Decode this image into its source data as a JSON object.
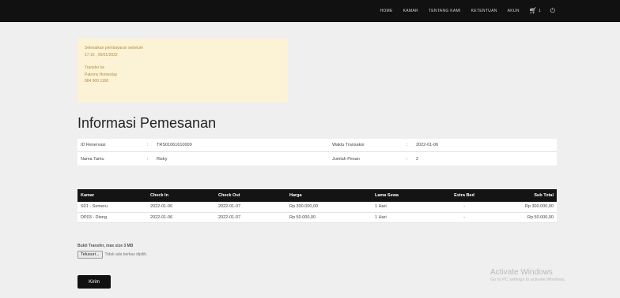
{
  "nav": {
    "links": [
      "HOME",
      "KAMAR",
      "TENTANG KAMI",
      "KETENTUAN",
      "AKUN"
    ],
    "cart_count": "1"
  },
  "notice": {
    "line1": "Selesaikan pembayaran sebelum",
    "line2": "17:16 , 06/01/2022",
    "line3": "Transfer ke",
    "line4": "Patrons Homestay",
    "line5": "884 900 1100"
  },
  "page_title": "Informasi Pemesanan",
  "info": {
    "rows": [
      {
        "label": "ID Reservasi",
        "value": "TRS01061610009",
        "label2": "Waktu Transaksi",
        "value2": "2022-01-06"
      },
      {
        "label": "Nama Tamu",
        "value": "Rizky",
        "label2": "Jumlah Pesan",
        "value2": "2"
      }
    ]
  },
  "table": {
    "headers": [
      "Kamar",
      "Check In",
      "Check Out",
      "Harga",
      "Lama Sewa",
      "Extra Bed",
      "Sub Total"
    ],
    "rows": [
      [
        "S01 - Semeru",
        "2022-01-06",
        "2022-01-07",
        "Rp 300.000,00",
        "1 Hari",
        "-",
        "Rp 300.000,00"
      ],
      [
        "DP03 - Dieng",
        "2022-01-06",
        "2022-01-07",
        "Rp 50.000,00",
        "1 Hari",
        "-",
        "Rp 50.000,00"
      ]
    ]
  },
  "upload": {
    "label": "Bukti Transfer, max size 3 MB",
    "button": "Telusuri...",
    "status": "Tidak ada berkas dipilih."
  },
  "submit_label": "Kirim",
  "watermark": {
    "line1": "Activate Windows",
    "line2": "Go to PC settings to activate Windows."
  }
}
